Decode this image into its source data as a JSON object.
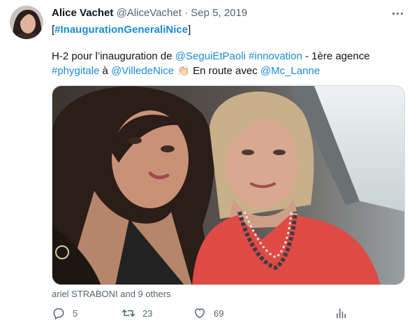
{
  "tweet": {
    "author_name": "Alice Vachet",
    "handle": "@AliceVachet",
    "separator": "·",
    "date": "Sep 5, 2019",
    "hashtag_line": {
      "open": "[",
      "hashtag": "#InaugurationGeneraliNice",
      "close": "]"
    },
    "body": {
      "t1": "H-2 pour l’inauguration de ",
      "mention1": "@SeguiEtPaoli",
      "t2": " ",
      "hashtag1": "#innovation",
      "t3": " - 1ère agence",
      "hashtag2": "#phygitale",
      "t4": " à ",
      "mention2": "@VilledeNice",
      "emoji": "👏🏻",
      "t5": " En route avec ",
      "mention3": "@Mc_Lanne"
    },
    "tagged_text": "ariel STRABONI and 9 others",
    "reply_count": "5",
    "retweet_count": "23",
    "like_count": "69"
  },
  "icons": {
    "more": "more-icon",
    "reply": "reply-icon",
    "retweet": "retweet-icon",
    "like": "heart-icon",
    "analytics": "analytics-icon"
  },
  "colors": {
    "link": "#1b8bd4",
    "secondary_text": "#536471",
    "primary_text": "#0f1419"
  }
}
